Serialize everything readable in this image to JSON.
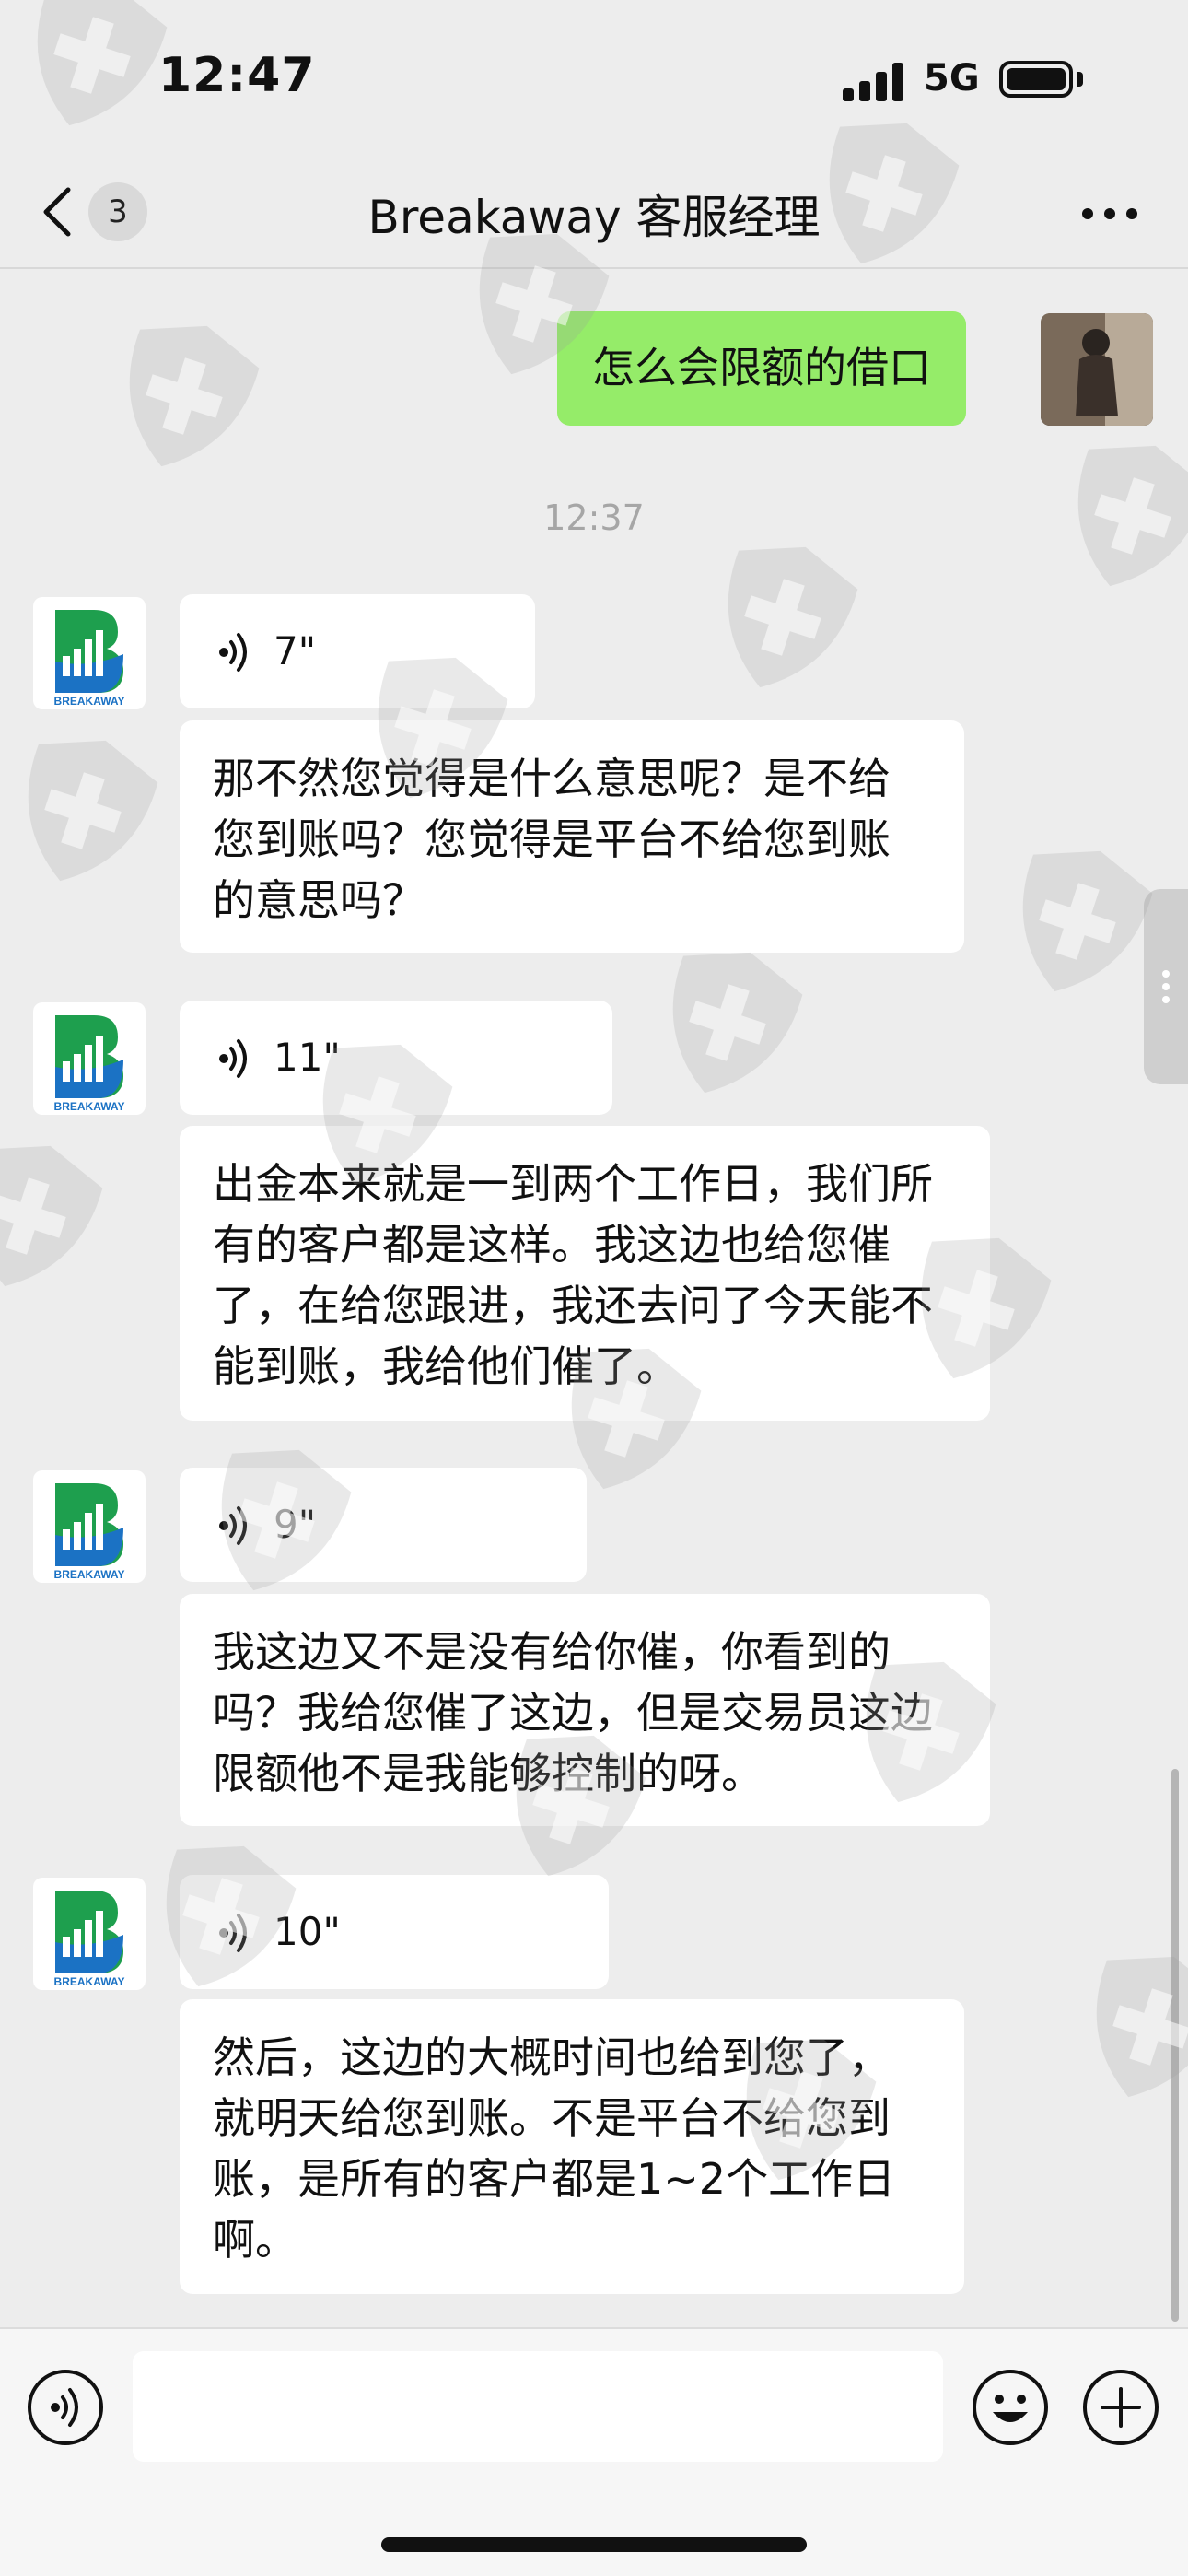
{
  "status_bar": {
    "time": "12:47",
    "network": "5G",
    "battery_icon": "battery-icon",
    "signal_icon": "signal-icon"
  },
  "header": {
    "unread_count": "3",
    "title": "Breakaway 客服经理",
    "back_icon": "chevron-left-icon",
    "more_icon": "more-dots-icon"
  },
  "messages": {
    "sent": {
      "text": "怎么会限额的借口"
    },
    "timestamp": "12:37",
    "received": [
      {
        "voice_duration": "7\"",
        "transcript": "那不然您觉得是什么意思呢？是不给您到账吗？您觉得是平台不给您到账的意思吗？"
      },
      {
        "voice_duration": "11\"",
        "transcript": "出金本来就是一到两个工作日，我们所有的客户都是这样。我这边也给您催了，在给您跟进，我还去问了今天能不能到账，我给他们催了。"
      },
      {
        "voice_duration": "9\"",
        "transcript": "我这边又不是没有给你催，你看到的吗？我给您催了这边，但是交易员这边限额他不是我能够控制的呀。"
      },
      {
        "voice_duration": "10\"",
        "transcript": "然后，这边的大概时间也给到您了，就明天给您到账。不是平台不给您到账，是所有的客户都是1~2个工作日啊。"
      }
    ],
    "agent_avatar_logo_text": "BREAKAWAY"
  },
  "input_bar": {
    "message_value": "",
    "voice_icon": "voice-toggle-icon",
    "emoji_icon": "emoji-icon",
    "plus_icon": "plus-icon"
  },
  "colors": {
    "background": "#ededed",
    "sent_bubble": "#95ec69",
    "received_bubble": "#ffffff",
    "logo_green": "#1e9f4e",
    "logo_blue": "#1b72c4"
  }
}
